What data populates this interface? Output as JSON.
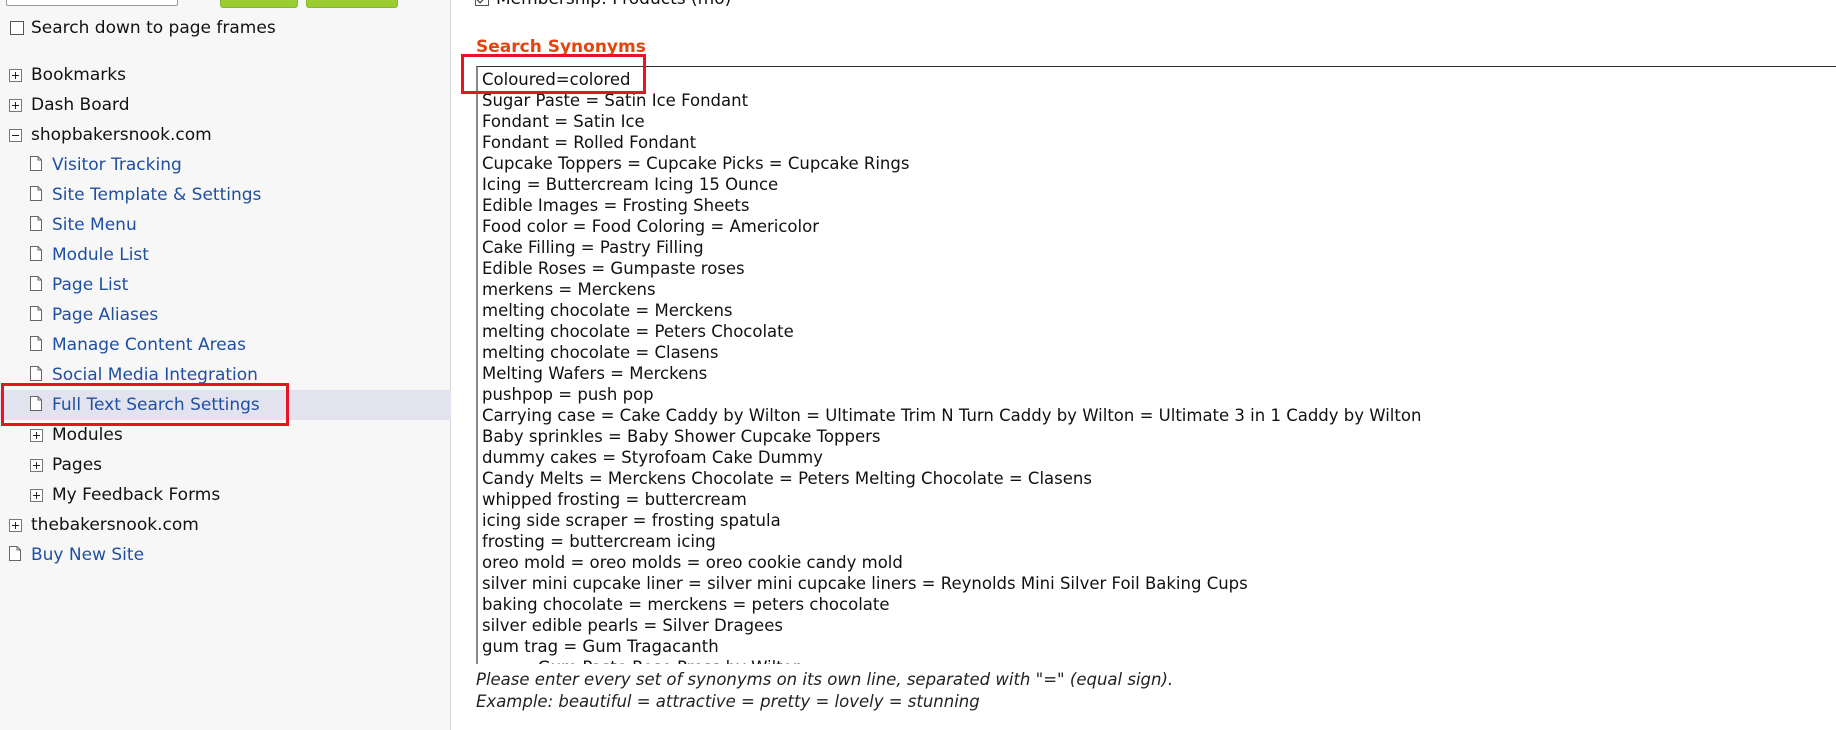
{
  "sidebar": {
    "search_frames_label": "Search down to page frames",
    "search_frames_checked": false,
    "tree": [
      {
        "label": "Bookmarks",
        "type": "expander",
        "expanded": false,
        "level": 0
      },
      {
        "label": "Dash Board",
        "type": "expander",
        "expanded": false,
        "level": 0
      },
      {
        "label": "shopbakersnook.com",
        "type": "expander",
        "expanded": true,
        "level": 0
      },
      {
        "label": "Visitor Tracking",
        "type": "page",
        "level": 1
      },
      {
        "label": "Site Template & Settings",
        "type": "page",
        "level": 1
      },
      {
        "label": "Site Menu",
        "type": "page",
        "level": 1
      },
      {
        "label": "Module List",
        "type": "page",
        "level": 1
      },
      {
        "label": "Page List",
        "type": "page",
        "level": 1
      },
      {
        "label": "Page Aliases",
        "type": "page",
        "level": 1
      },
      {
        "label": "Manage Content Areas",
        "type": "page",
        "level": 1
      },
      {
        "label": "Social Media Integration",
        "type": "page",
        "level": 1
      },
      {
        "label": "Full Text Search Settings",
        "type": "page",
        "level": 1,
        "selected": true
      },
      {
        "label": "Modules",
        "type": "expander",
        "expanded": false,
        "level": 1
      },
      {
        "label": "Pages",
        "type": "expander",
        "expanded": false,
        "level": 1
      },
      {
        "label": "My Feedback Forms",
        "type": "expander",
        "expanded": false,
        "level": 1
      },
      {
        "label": "thebakersnook.com",
        "type": "expander",
        "expanded": false,
        "level": 0
      },
      {
        "label": "Buy New Site",
        "type": "page",
        "level": 0
      }
    ]
  },
  "main": {
    "top_checkbox_label": "Membership: Products (mo)",
    "top_checkbox_checked": true,
    "section_title": "Search Synonyms",
    "synonyms": [
      "Coloured=colored",
      "Sugar Paste = Satin Ice Fondant",
      "Fondant = Satin Ice",
      "Fondant = Rolled Fondant",
      "Cupcake Toppers = Cupcake Picks = Cupcake Rings",
      "Icing = Buttercream Icing 15 Ounce",
      "Edible Images = Frosting Sheets",
      "Food color = Food Coloring = Americolor",
      "Cake Filling = Pastry Filling",
      "Edible Roses = Gumpaste roses",
      "merkens = Merckens",
      "melting chocolate = Merckens",
      "melting chocolate = Peters Chocolate",
      "melting chocolate = Clasens",
      "Melting Wafers = Merckens",
      "pushpop = push pop",
      "Carrying case = Cake Caddy by Wilton = Ultimate Trim N Turn Caddy by Wilton = Ultimate 3 in 1 Caddy by Wilton",
      "Baby sprinkles = Baby Shower Cupcake Toppers",
      "dummy cakes = Styrofoam Cake Dummy",
      "Candy Melts = Merckens Chocolate = Peters Melting Chocolate = Clasens",
      "whipped frosting = buttercream",
      "icing side scraper = frosting spatula",
      "frosting = buttercream icing",
      "oreo mold = oreo molds = oreo cookie candy mold",
      "silver mini cupcake liner = silver mini cupcake liners = Reynolds Mini Silver Foil Baking Cups",
      "baking chocolate = merckens = peters chocolate",
      "silver edible pearls = Silver Dragees",
      "gum trag = Gum Tragacanth",
      "...... = Gum Paste Rose Press by Wilton"
    ],
    "help_line_1": "Please enter every set of synonyms on its own line, separated with \"=\" (equal sign).",
    "help_line_2": "Example: beautiful = attractive = pretty = lovely = stunning"
  },
  "colors": {
    "link": "#1f4fa0",
    "section_title": "#e8420d",
    "highlight": "#ee1122",
    "selected_row": "#e2e3ee",
    "button": "#9acd32"
  },
  "icons": {
    "page": "page-icon",
    "expand": "plus-box-icon",
    "collapse": "minus-box-icon"
  }
}
